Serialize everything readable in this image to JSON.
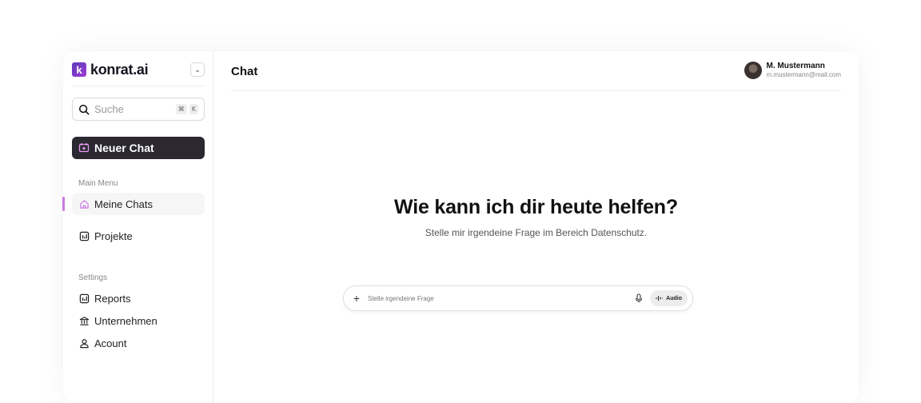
{
  "brand": {
    "name": "konrat.ai",
    "logo_letter": "k",
    "logo_color": "#6a3bc4"
  },
  "search": {
    "placeholder": "Suche",
    "shortcut_mod": "⌘",
    "shortcut_key": "K"
  },
  "new_chat": {
    "label": "Neuer Chat",
    "bg_color": "#2b2832"
  },
  "main_menu": {
    "title": "Main Menu",
    "items": [
      {
        "label": "Meine Chats",
        "icon": "home-icon",
        "active": true
      },
      {
        "label": "Projekte",
        "icon": "chart-icon",
        "active": false
      }
    ]
  },
  "settings": {
    "title": "Settings",
    "items": [
      {
        "label": "Reports",
        "icon": "chart-icon"
      },
      {
        "label": "Unternehmen",
        "icon": "bank-icon"
      },
      {
        "label": "Acount",
        "icon": "user-icon"
      }
    ]
  },
  "accent_color": "#c77be0",
  "header": {
    "title": "Chat"
  },
  "user": {
    "name": "M. Mustermann",
    "email": "m.mustermann@mail.com"
  },
  "hero": {
    "title": "Wie kann ich dir heute helfen?",
    "subtitle": "Stelle mir irgendeine Frage im Bereich Datenschutz."
  },
  "composer": {
    "placeholder": "Stelle irgendeine Frage",
    "audio_label": "Audio"
  }
}
